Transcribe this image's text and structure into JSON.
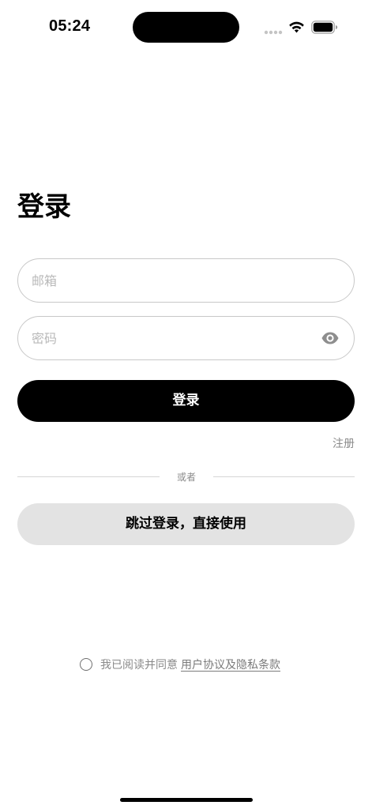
{
  "status_bar": {
    "time": "05:24",
    "icons": [
      "cellular-dots-icon",
      "wifi-icon",
      "battery-icon"
    ]
  },
  "login": {
    "title": "登录",
    "email": {
      "value": "",
      "placeholder": "邮箱"
    },
    "password": {
      "value": "",
      "placeholder": "密码",
      "toggle_icon": "eye-icon"
    },
    "submit_label": "登录",
    "register_label": "注册",
    "divider_text": "或者",
    "skip_label": "跳过登录，直接使用",
    "agreement": {
      "checked": false,
      "text": "我已阅读并同意",
      "link_text": "用户协议及隐私条款"
    }
  },
  "colors": {
    "primary": "#000000",
    "secondary_button": "#e3e3e3",
    "muted_text": "#8a8a8a",
    "border": "#c8c8c8"
  }
}
